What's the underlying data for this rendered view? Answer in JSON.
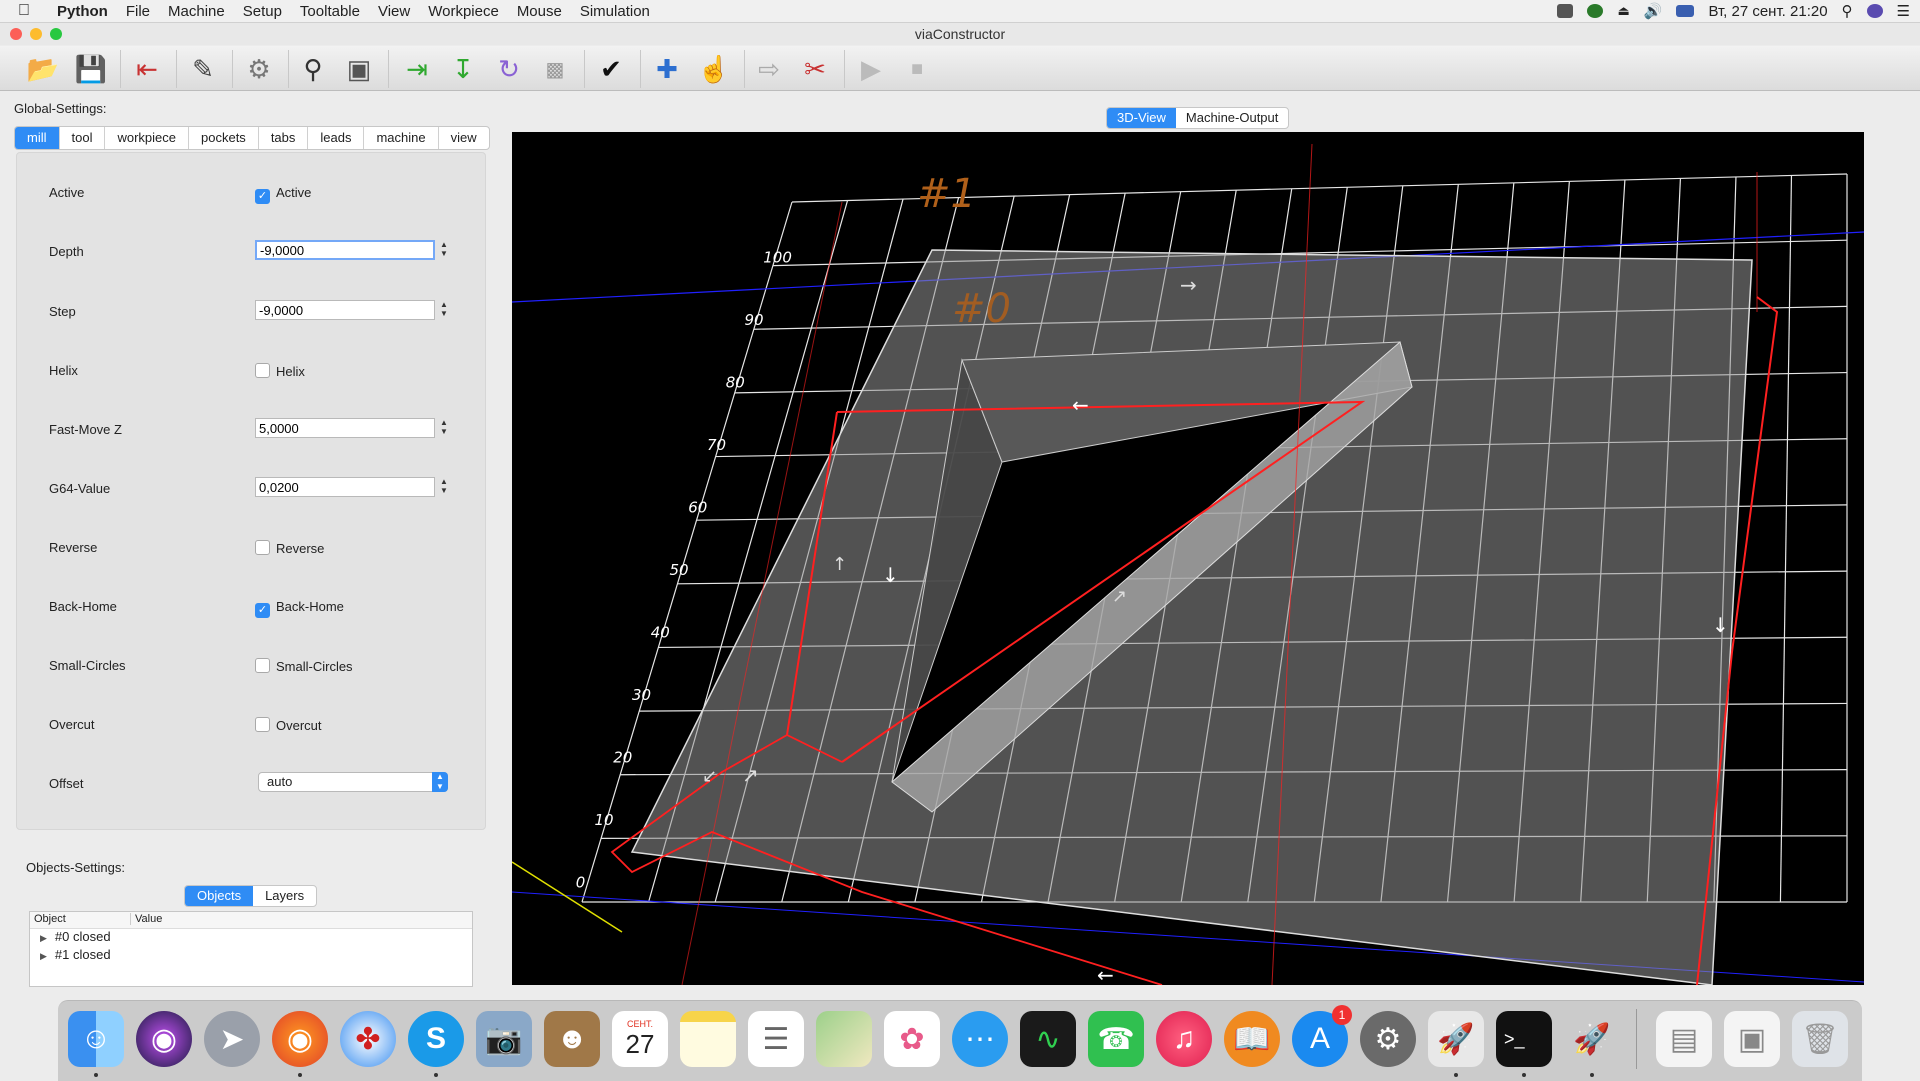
{
  "menubar": {
    "app_name": "Python",
    "items": [
      "File",
      "Machine",
      "Setup",
      "Tooltable",
      "View",
      "Workpiece",
      "Mouse",
      "Simulation"
    ],
    "clock": "Вт, 27 сент.  21:20"
  },
  "window": {
    "title": "viaConstructor"
  },
  "toolbar": {
    "icons": [
      "open-file-icon",
      "save-icon",
      "exit-icon",
      "edit-icon",
      "tools-icon",
      "search-icon",
      "view-icon",
      "import-icon",
      "download-icon",
      "redo-icon",
      "clipboard-icon",
      "check-icon",
      "add-icon",
      "select-icon",
      "move-icon",
      "cut-icon",
      "play-icon",
      "stop-icon"
    ]
  },
  "global_settings": {
    "label": "Global-Settings:",
    "tabs": [
      "mill",
      "tool",
      "workpiece",
      "pockets",
      "tabs",
      "leads",
      "machine",
      "view"
    ],
    "active_tab": "mill",
    "fields": {
      "active": {
        "label": "Active",
        "checkbox_label": "Active",
        "checked": true
      },
      "depth": {
        "label": "Depth",
        "value": "-9,0000"
      },
      "step": {
        "label": "Step",
        "value": "-9,0000"
      },
      "helix": {
        "label": "Helix",
        "checkbox_label": "Helix",
        "checked": false
      },
      "fast_move_z": {
        "label": "Fast-Move Z",
        "value": "5,0000"
      },
      "g64_value": {
        "label": "G64-Value",
        "value": "0,0200"
      },
      "reverse": {
        "label": "Reverse",
        "checkbox_label": "Reverse",
        "checked": false
      },
      "back_home": {
        "label": "Back-Home",
        "checkbox_label": "Back-Home",
        "checked": true
      },
      "small_circles": {
        "label": "Small-Circles",
        "checkbox_label": "Small-Circles",
        "checked": false
      },
      "overcut": {
        "label": "Overcut",
        "checkbox_label": "Overcut",
        "checked": false
      },
      "offset": {
        "label": "Offset",
        "value": "auto"
      }
    }
  },
  "objects_settings": {
    "label": "Objects-Settings:",
    "tabs": [
      "Objects",
      "Layers"
    ],
    "active_tab": "Objects",
    "columns": [
      "Object",
      "Value"
    ],
    "items": [
      "#0 closed",
      "#1 closed"
    ]
  },
  "view": {
    "tabs": [
      "3D-View",
      "Machine-Output"
    ],
    "active_tab": "3D-View",
    "object_labels": [
      "#1",
      "#0"
    ],
    "axis_ticks": [
      "100",
      "90",
      "80",
      "70",
      "60",
      "50",
      "40",
      "30",
      "20",
      "10",
      "0"
    ],
    "colors": {
      "grid": "#ffffff",
      "toolpath": "#ff2020",
      "axis_x": "#e0e000",
      "axis_y": "#2020ff",
      "label": "#b0601a"
    }
  },
  "dock": {
    "calendar_month": "СЕНТ.",
    "calendar_day": "27",
    "appstore_badge": "1",
    "apps": [
      "finder",
      "siri",
      "launchpad",
      "firefox",
      "safari",
      "skype",
      "preview",
      "contacts",
      "calendar",
      "notes",
      "reminders",
      "maps",
      "photos",
      "messages",
      "activity-monitor",
      "facetime",
      "music",
      "books",
      "app-store",
      "system-preferences",
      "python-launcher",
      "terminal",
      "rocket",
      "document",
      "screenshot",
      "trash"
    ]
  }
}
